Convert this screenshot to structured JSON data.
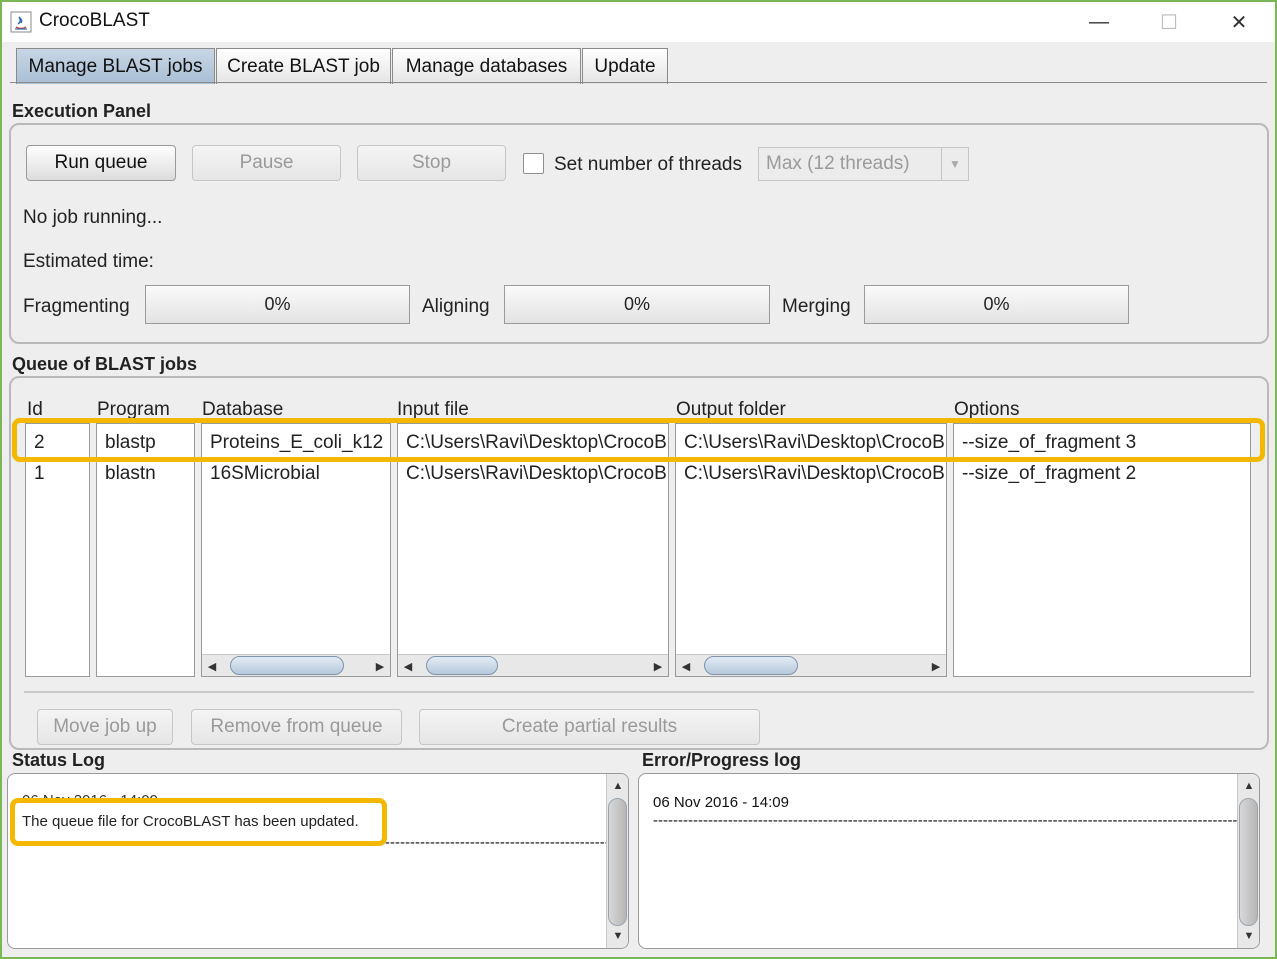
{
  "window": {
    "title": "CrocoBLAST",
    "minimize": "—",
    "maximize": "☐",
    "close": "✕"
  },
  "tabs": [
    {
      "label": "Manage BLAST jobs",
      "active": true
    },
    {
      "label": "Create BLAST job",
      "active": false
    },
    {
      "label": "Manage databases",
      "active": false
    },
    {
      "label": "Update",
      "active": false
    }
  ],
  "execution": {
    "title": "Execution Panel",
    "run_queue": "Run queue",
    "pause": "Pause",
    "stop": "Stop",
    "threads_label": "Set number of threads",
    "threads_value": "Max (12 threads)",
    "status": "No job running...",
    "estimated_time": "Estimated time:",
    "fragmenting_label": "Fragmenting",
    "fragmenting_value": "0%",
    "aligning_label": "Aligning",
    "aligning_value": "0%",
    "merging_label": "Merging",
    "merging_value": "0%"
  },
  "queue": {
    "title": "Queue of BLAST jobs",
    "columns": [
      "Id",
      "Program",
      "Database",
      "Input file",
      "Output folder",
      "Options"
    ],
    "rows": [
      [
        "2",
        "blastp",
        "Proteins_E_coli_k12",
        "C:\\Users\\Ravi\\Desktop\\CrocoBLAST",
        "C:\\Users\\Ravi\\Desktop\\CrocoBLAST",
        "--size_of_fragment 3"
      ],
      [
        "1",
        "blastn",
        "16SMicrobial",
        "C:\\Users\\Ravi\\Desktop\\CrocoBLAST",
        "C:\\Users\\Ravi\\Desktop\\CrocoBLAST",
        "--size_of_fragment 2"
      ]
    ],
    "move_up": "Move job up",
    "remove": "Remove from queue",
    "partial": "Create partial results"
  },
  "status_log": {
    "title": "Status Log",
    "timestamp": "06 Nov 2016 - 14:09",
    "message": "The queue file for CrocoBLAST has been updated.",
    "separator": "----------------------------------------------------------------------"
  },
  "error_log": {
    "title": "Error/Progress log",
    "timestamp": "06 Nov 2016 - 14:09",
    "separator": "------------------------------------------------------------------------------------------------------------------------"
  },
  "colors": {
    "highlight": "#f5b800",
    "tab_active": "#a9bfd6"
  }
}
